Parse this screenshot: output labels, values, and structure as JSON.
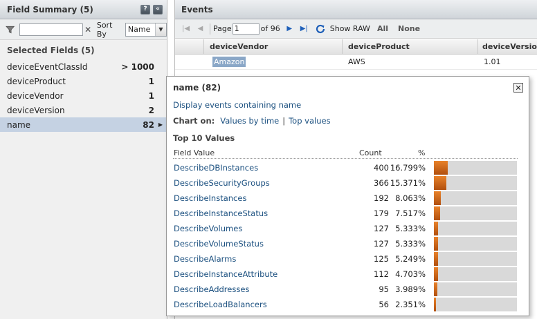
{
  "field_summary": {
    "title": "Field Summary (5)",
    "help_label": "?",
    "collapse_label": "«",
    "sort_by_label": "Sort By",
    "sort_value": "Name",
    "search_value": "",
    "clear_label": "✕",
    "selected_title": "Selected Fields (5)",
    "fields": [
      {
        "name": "deviceEventClassId",
        "count": "> 1000"
      },
      {
        "name": "deviceProduct",
        "count": "1"
      },
      {
        "name": "deviceVendor",
        "count": "1"
      },
      {
        "name": "deviceVersion",
        "count": "2"
      },
      {
        "name": "name",
        "count": "82"
      }
    ]
  },
  "events": {
    "title": "Events",
    "page_label": "Page",
    "page_value": "1",
    "of_label": "of 96",
    "show_raw": "Show RAW",
    "all": "All",
    "none": "None",
    "columns": [
      "deviceVendor",
      "deviceProduct",
      "deviceVersion"
    ],
    "first_row": {
      "vendor": "Amazon",
      "product": "AWS",
      "version": "1.01"
    }
  },
  "popup": {
    "title": "name (82)",
    "close_label": "✕",
    "display_link": "Display events containing name",
    "chart_on_label": "Chart on:",
    "values_by_time": "Values by time",
    "pipe": "|",
    "top_values_link": "Top values",
    "top_title": "Top 10 Values",
    "headers": {
      "field_value": "Field Value",
      "count": "Count",
      "percent": "%"
    },
    "rows": [
      {
        "value": "DescribeDBInstances",
        "count": "400",
        "pct": "16.799%",
        "pct_num": 16.799
      },
      {
        "value": "DescribeSecurityGroups",
        "count": "366",
        "pct": "15.371%",
        "pct_num": 15.371
      },
      {
        "value": "DescribeInstances",
        "count": "192",
        "pct": "8.063%",
        "pct_num": 8.063
      },
      {
        "value": "DescribeInstanceStatus",
        "count": "179",
        "pct": "7.517%",
        "pct_num": 7.517
      },
      {
        "value": "DescribeVolumes",
        "count": "127",
        "pct": "5.333%",
        "pct_num": 5.333
      },
      {
        "value": "DescribeVolumeStatus",
        "count": "127",
        "pct": "5.333%",
        "pct_num": 5.333
      },
      {
        "value": "DescribeAlarms",
        "count": "125",
        "pct": "5.249%",
        "pct_num": 5.249
      },
      {
        "value": "DescribeInstanceAttribute",
        "count": "112",
        "pct": "4.703%",
        "pct_num": 4.703
      },
      {
        "value": "DescribeAddresses",
        "count": "95",
        "pct": "3.989%",
        "pct_num": 3.989
      },
      {
        "value": "DescribeLoadBalancers",
        "count": "56",
        "pct": "2.351%",
        "pct_num": 2.351
      }
    ],
    "bar_scale_max_pct": 100
  },
  "colors": {
    "bar": "#d06a1c",
    "link": "#1a4f7f",
    "selected_row": "#c5d2e3"
  }
}
